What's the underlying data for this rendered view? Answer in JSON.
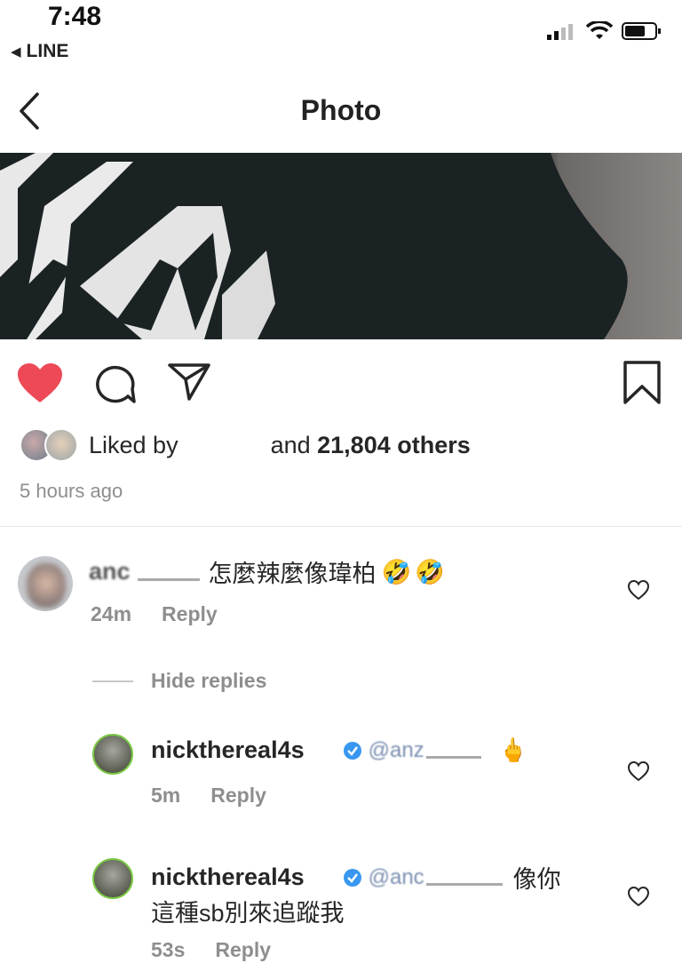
{
  "status_bar": {
    "time": "7:48",
    "back_app": "LINE"
  },
  "nav": {
    "title": "Photo"
  },
  "likes": {
    "prefix": "Liked by",
    "suffix_pre": "and ",
    "count": "21,804",
    "suffix_post": " others"
  },
  "post_time": "5 hours ago",
  "comments": [
    {
      "username": "anc",
      "text": "怎麼辣麼像瑋柏",
      "emoji": "🤣🤣",
      "time": "24m",
      "reply_label": "Reply"
    }
  ],
  "hide_replies_label": "Hide replies",
  "replies": [
    {
      "username": "nickthereal4s",
      "mention": "@anz",
      "emoji": "🖕",
      "time": "5m",
      "reply_label": "Reply",
      "text": ""
    },
    {
      "username": "nickthereal4s",
      "mention": "@anc",
      "text_line1": "像你",
      "text_line2": "這種sb別來追蹤我",
      "time": "53s",
      "reply_label": "Reply"
    }
  ],
  "colors": {
    "heart_red": "#ed4956",
    "verified_blue": "#3897f0",
    "meta_gray": "#8e8e8e"
  }
}
